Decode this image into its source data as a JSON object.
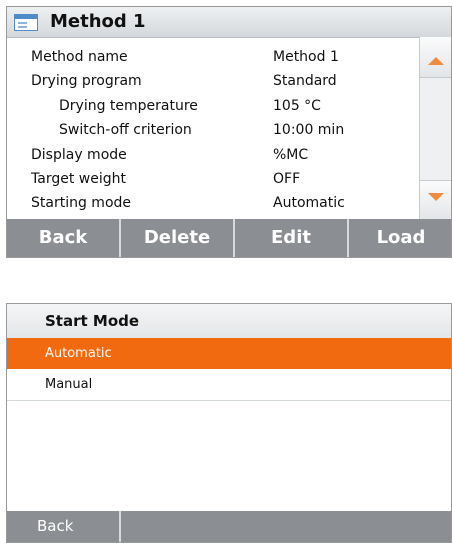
{
  "method_screen": {
    "title": "Method 1",
    "rows": [
      {
        "label": "Method name",
        "value": "Method 1",
        "indent": false
      },
      {
        "label": "Drying program",
        "value": "Standard",
        "indent": false
      },
      {
        "label": "Drying temperature",
        "value": "105 °C",
        "indent": true
      },
      {
        "label": "Switch-off criterion",
        "value": "10:00 min",
        "indent": true
      },
      {
        "label": "Display mode",
        "value": "%MC",
        "indent": false
      },
      {
        "label": "Target weight",
        "value": "OFF",
        "indent": false
      },
      {
        "label": "Starting mode",
        "value": "Automatic",
        "indent": false
      }
    ],
    "buttons": {
      "back": "Back",
      "delete": "Delete",
      "edit": "Edit",
      "load": "Load"
    }
  },
  "start_mode_screen": {
    "title": "Start Mode",
    "options": [
      {
        "label": "Automatic",
        "selected": true
      },
      {
        "label": "Manual",
        "selected": false
      }
    ],
    "back": "Back"
  },
  "colors": {
    "accent": "#f26a10",
    "scroll_arrow": "#f08a3c",
    "button_bar": "#8b8e92",
    "title_bar": "#d4d8dc"
  },
  "icons": {
    "app": "window-icon",
    "scroll_up": "triangle-up-icon",
    "scroll_down": "triangle-down-icon"
  }
}
